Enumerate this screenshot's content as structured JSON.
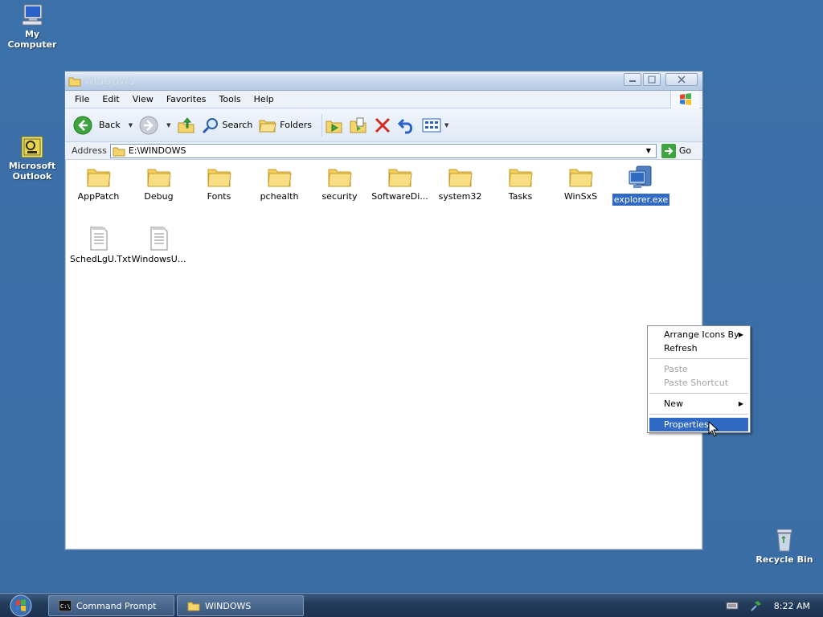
{
  "desktop": {
    "icons": [
      {
        "label": "My Computer",
        "icon": "computer-icon"
      },
      {
        "label": "Microsoft Outlook",
        "icon": "outlook-icon"
      },
      {
        "label": "Recycle Bin",
        "icon": "recycle-bin-icon"
      }
    ]
  },
  "window": {
    "title": "WINDOWS",
    "menu": [
      "File",
      "Edit",
      "View",
      "Favorites",
      "Tools",
      "Help"
    ],
    "toolbar": {
      "back": "Back",
      "search": "Search",
      "folders": "Folders"
    },
    "address": {
      "label": "Address",
      "value": "E:\\WINDOWS",
      "go": "Go"
    },
    "files": [
      {
        "name": "AppPatch",
        "type": "folder"
      },
      {
        "name": "Debug",
        "type": "folder"
      },
      {
        "name": "Fonts",
        "type": "folder"
      },
      {
        "name": "pchealth",
        "type": "folder"
      },
      {
        "name": "security",
        "type": "folder"
      },
      {
        "name": "SoftwareDi...",
        "type": "folder"
      },
      {
        "name": "system32",
        "type": "folder"
      },
      {
        "name": "Tasks",
        "type": "folder"
      },
      {
        "name": "WinSxS",
        "type": "folder"
      },
      {
        "name": "explorer.exe",
        "type": "exe",
        "selected": true
      },
      {
        "name": "SchedLgU.Txt",
        "type": "text"
      },
      {
        "name": "WindowsU...",
        "type": "text"
      }
    ]
  },
  "context_menu": {
    "items": [
      {
        "label": "Arrange Icons By",
        "submenu": true
      },
      {
        "label": "Refresh"
      },
      {
        "label": "Paste",
        "disabled": true
      },
      {
        "label": "Paste Shortcut",
        "disabled": true
      },
      {
        "label": "New",
        "submenu": true
      },
      {
        "label": "Properties",
        "highlighted": true
      }
    ]
  },
  "taskbar": {
    "tasks": [
      "Command Prompt",
      "WINDOWS"
    ],
    "clock": "8:22 AM"
  },
  "colors": {
    "desktop": "#3a6ea5",
    "selection": "#316ac5",
    "taskbar": "#243d5c"
  }
}
